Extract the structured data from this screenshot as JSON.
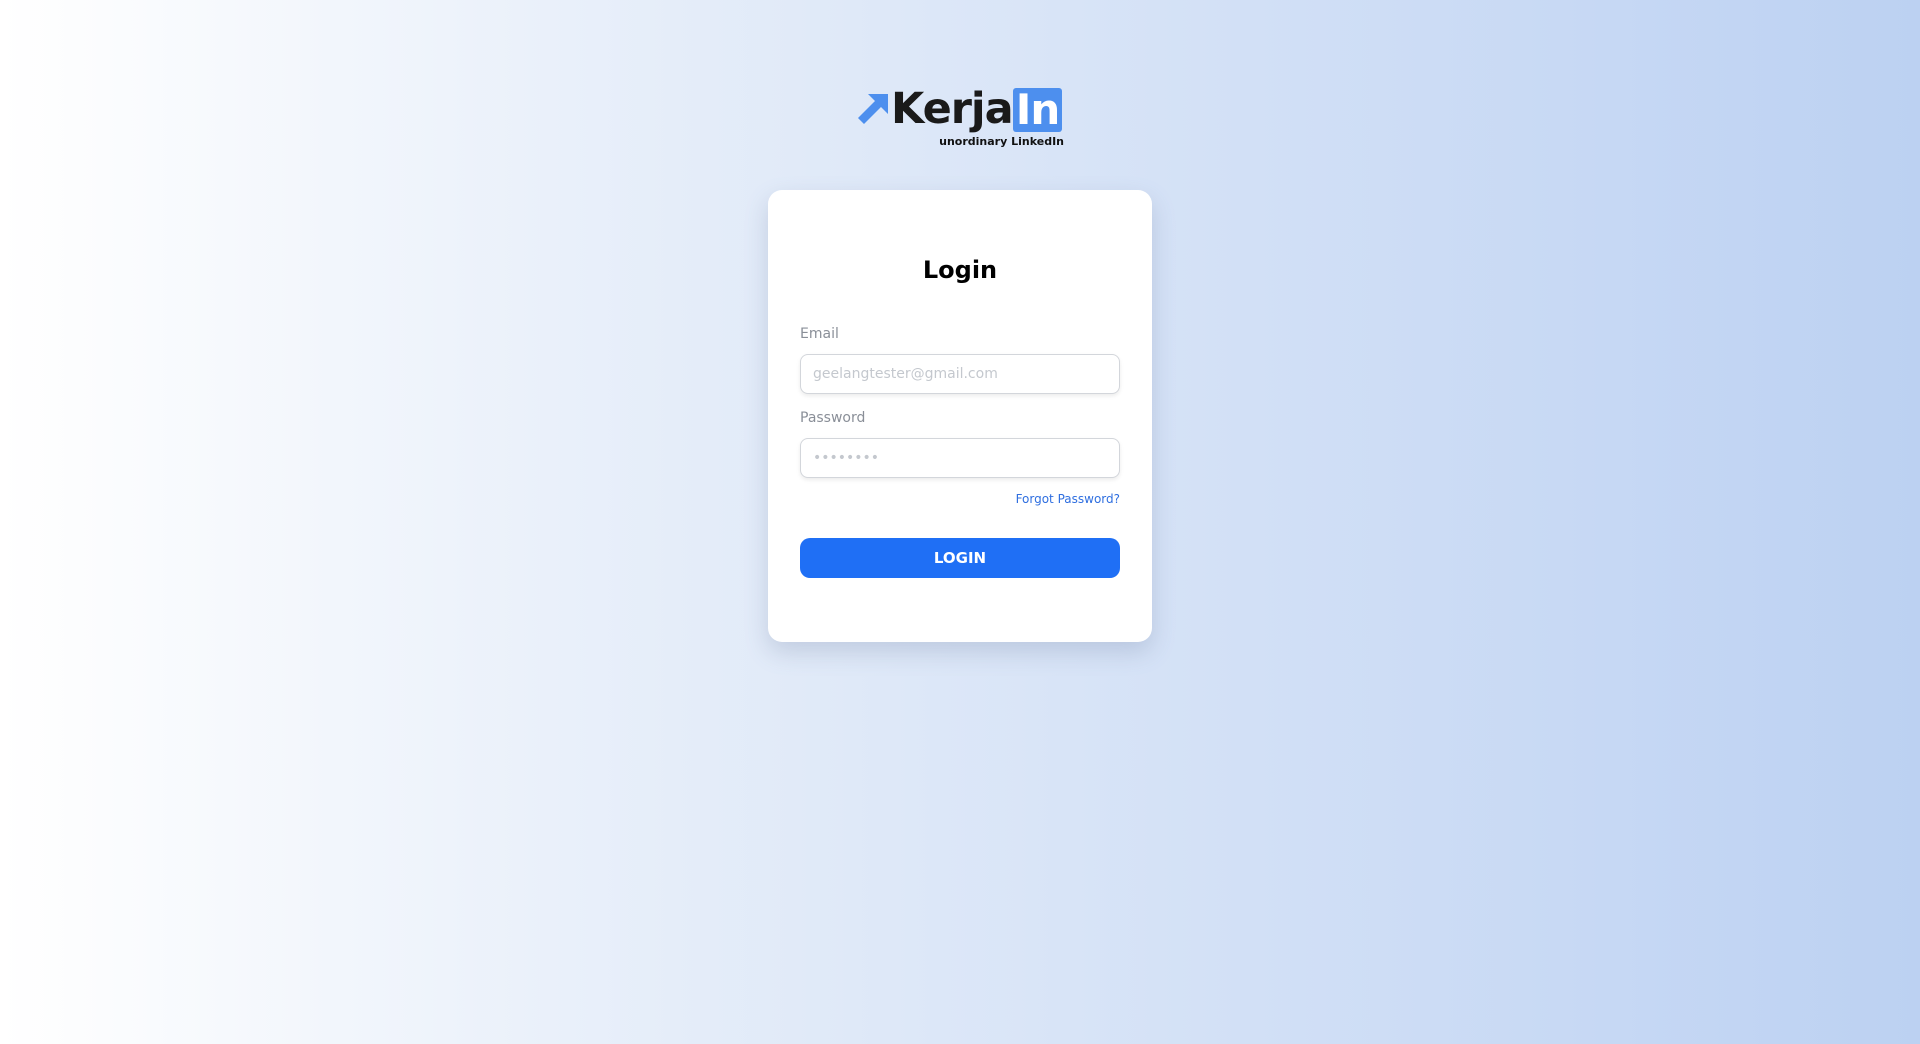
{
  "brand": {
    "name_main": "Kerja",
    "name_box": "In",
    "tagline": "unordinary LinkedIn",
    "arrow_icon": "arrow-up-right-icon",
    "colors": {
      "wordmark": "#1a1a1a",
      "box": "#4d8fee",
      "arrow": "#4d8fee"
    }
  },
  "login_form": {
    "title": "Login",
    "email": {
      "label": "Email",
      "placeholder": "geelangtester@gmail.com",
      "value": ""
    },
    "password": {
      "label": "Password",
      "placeholder": "••••••••",
      "value": ""
    },
    "forgot_password": "Forgot Password?",
    "submit_label": "LOGIN"
  },
  "colors": {
    "accent": "#1f6ff5",
    "link": "#2f6fe0",
    "background_start": "#ffffff",
    "background_end": "#bcd1f2"
  }
}
